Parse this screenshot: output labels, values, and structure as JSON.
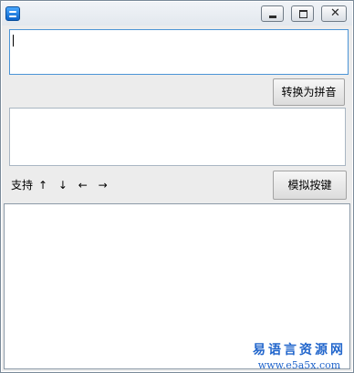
{
  "window": {
    "title": ""
  },
  "convert_button": {
    "label": "转换为拼音"
  },
  "simulate_button": {
    "label": "模拟按键"
  },
  "support_label": {
    "text": "支持",
    "arrows": "↑ ↓ ← →"
  },
  "input_box": {
    "value": ""
  },
  "output_box": {
    "value": ""
  },
  "log_box": {
    "value": ""
  },
  "watermark": {
    "line1": "易语言资源网",
    "line2": "www.e5a5x.com"
  },
  "icons": {
    "app": "app-icon",
    "minimize": "minimize-icon",
    "maximize": "maximize-icon",
    "close": "close-icon"
  }
}
